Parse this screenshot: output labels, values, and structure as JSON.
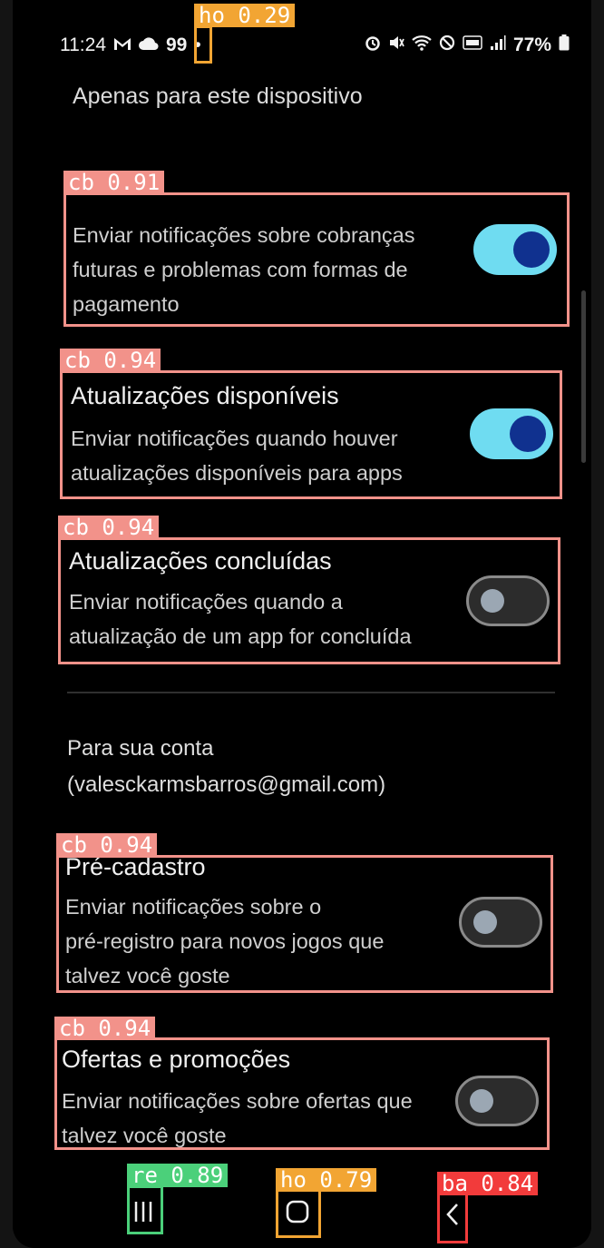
{
  "status_bar": {
    "time": "11:24",
    "left_icons": [
      "gmail-icon",
      "cloud-icon"
    ],
    "badge": "99",
    "dot": "•",
    "battery": "77%",
    "right_icons": [
      "alarm-icon",
      "mute-icon",
      "wifi-icon",
      "dnd-icon",
      "volte-icon",
      "signal-icon",
      "battery-icon"
    ]
  },
  "header": {
    "title": "Apenas para este dispositivo"
  },
  "settings": [
    {
      "title": "",
      "description_lines": [
        "Enviar notificações sobre cobranças",
        "futuras e problemas com formas de",
        "pagamento"
      ],
      "enabled": true
    },
    {
      "title": "Atualizações disponíveis",
      "description_lines": [
        "Enviar notificações quando houver",
        "atualizações disponíveis para apps"
      ],
      "enabled": true
    },
    {
      "title": "Atualizações concluídas",
      "description_lines": [
        "Enviar notificações quando a",
        "atualização de um app for concluída"
      ],
      "enabled": false
    },
    {
      "title": "Pré-cadastro",
      "description_lines": [
        "Enviar notificações sobre o",
        "pré-registro para novos jogos que",
        "talvez você goste"
      ],
      "enabled": false
    },
    {
      "title": "Ofertas e promoções",
      "description_lines": [
        "Enviar notificações sobre ofertas que",
        "talvez você goste"
      ],
      "enabled": false
    }
  ],
  "section": {
    "label": "Para sua conta",
    "email": "(valesckarmsbarros@gmail.com)"
  },
  "annotations": {
    "status_dot": "ho 0.29",
    "setting_0": "cb 0.91",
    "setting_1": "cb 0.94",
    "setting_2": "cb 0.94",
    "setting_3": "cb 0.94",
    "setting_4": "cb 0.94",
    "nav_recent": "re 0.89",
    "nav_home": "ho 0.79",
    "nav_back": "ba 0.84"
  },
  "colors": {
    "toggle_on_track": "#6fdcf1",
    "toggle_on_knob": "#10318f",
    "annotation_checkbox": "#f2928a",
    "annotation_home": "#f2a533",
    "annotation_recent": "#4bd07a",
    "annotation_back": "#f23b3b"
  }
}
